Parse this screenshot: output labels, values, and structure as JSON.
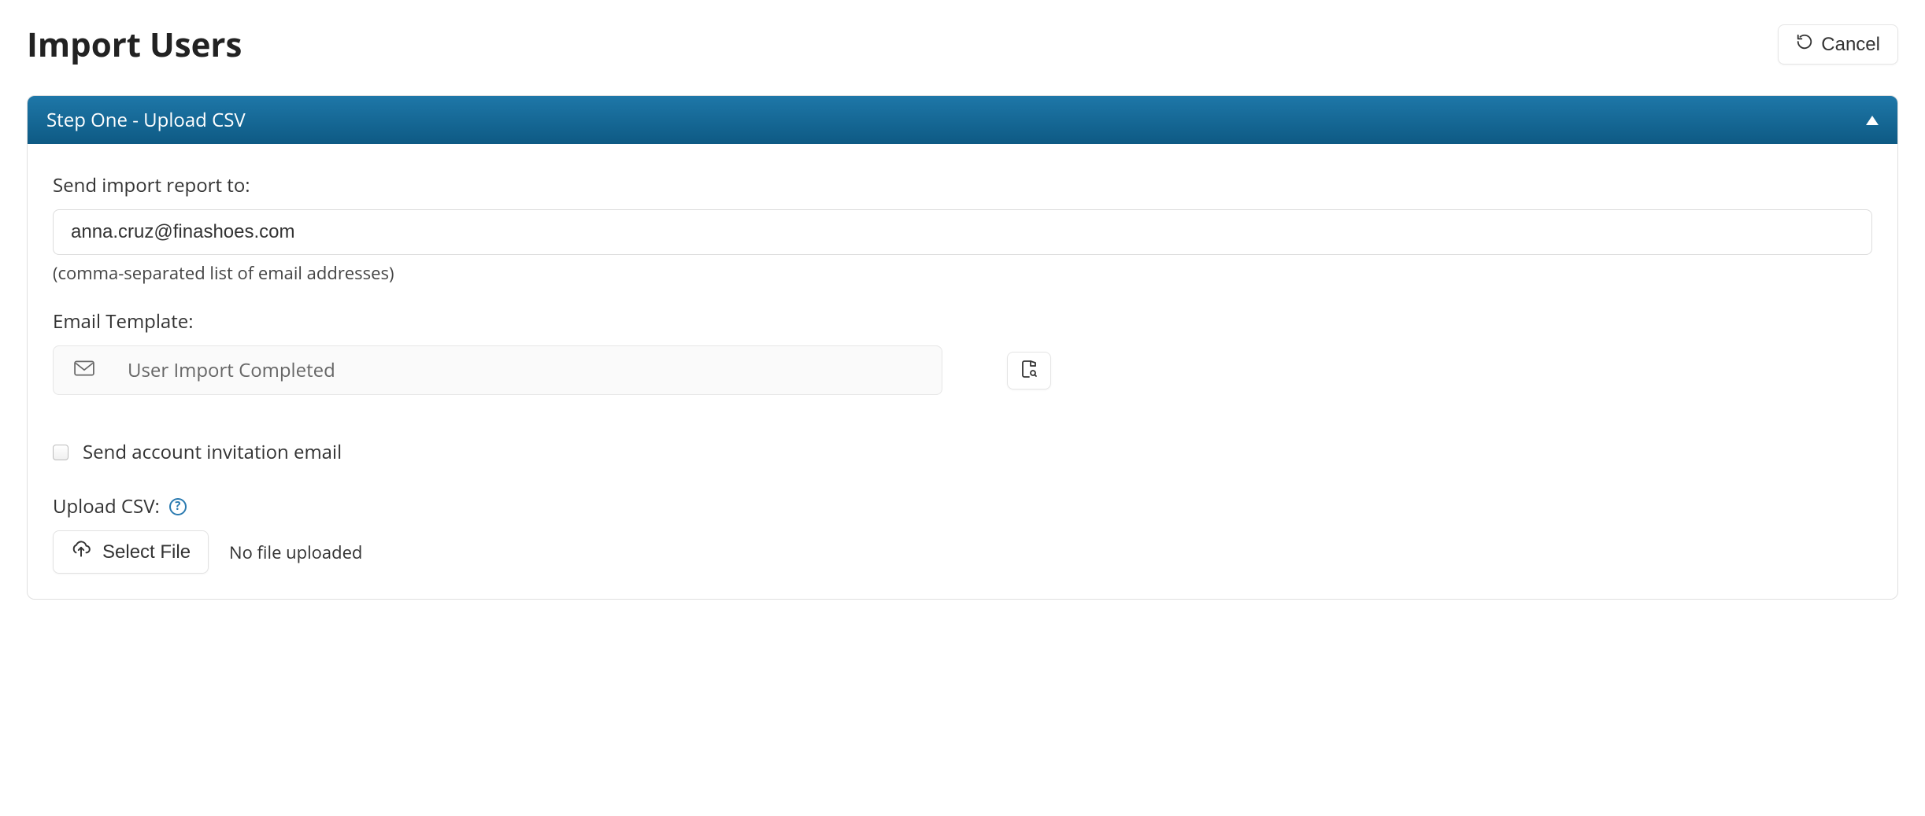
{
  "header": {
    "title": "Import Users",
    "cancel_label": "Cancel"
  },
  "step": {
    "title": "Step One - Upload CSV",
    "report_label": "Send import report to:",
    "report_value": "anna.cruz@finashoes.com",
    "report_hint": "(comma-separated list of email addresses)",
    "template_label": "Email Template:",
    "template_value": "User Import Completed",
    "invite_label": "Send account invitation email",
    "invite_checked": false,
    "upload_label": "Upload CSV:",
    "select_file_label": "Select File",
    "file_status": "No file uploaded"
  }
}
